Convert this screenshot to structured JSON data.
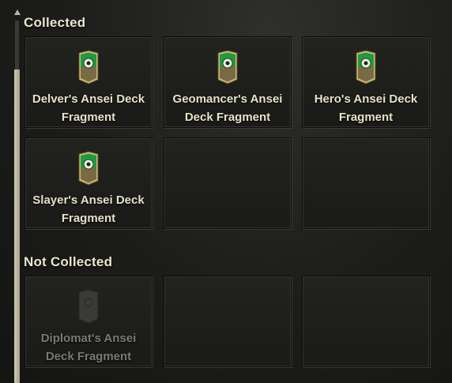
{
  "sections": {
    "collected": {
      "title": "Collected",
      "items": [
        {
          "label": "Delver's Ansei Deck Fragment",
          "icon": "ansei-deck-fragment-icon"
        },
        {
          "label": "Geomancer's Ansei Deck Fragment",
          "icon": "ansei-deck-fragment-icon"
        },
        {
          "label": "Hero's Ansei Deck Fragment",
          "icon": "ansei-deck-fragment-icon"
        },
        {
          "label": "Slayer's Ansei Deck Fragment",
          "icon": "ansei-deck-fragment-icon"
        }
      ]
    },
    "not_collected": {
      "title": "Not Collected",
      "items": [
        {
          "label": "Diplomat's Ansei Deck Fragment",
          "icon": "locked-fragment-icon"
        }
      ]
    }
  },
  "colors": {
    "label_collected": "#e8e2c8",
    "label_not_collected": "#7b7a70",
    "icon_green": "#1f9a3c",
    "icon_gold": "#c8b36a"
  }
}
